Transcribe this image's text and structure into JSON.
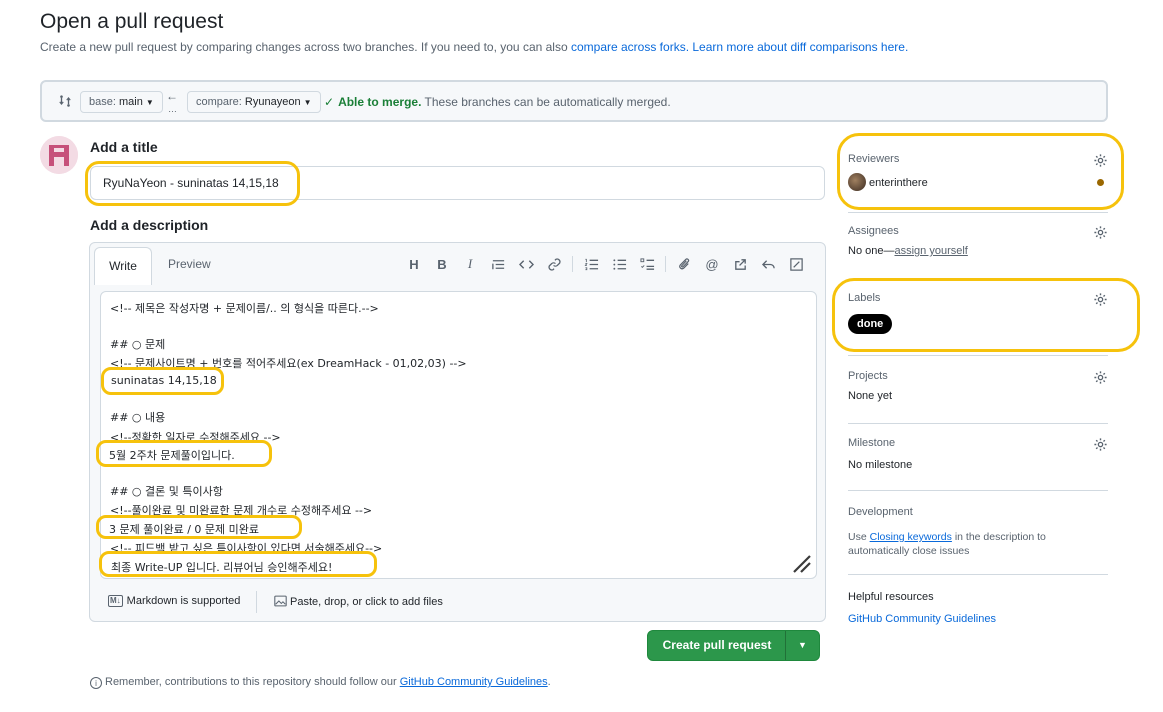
{
  "header": {
    "title": "Open a pull request",
    "subtitle_text": "Create a new pull request by comparing changes across two branches. If you need to, you can also",
    "compare_forks_link": "compare across forks.",
    "learn_more_link": "Learn more about diff comparisons here."
  },
  "branches": {
    "base_prefix": "base:",
    "base_value": "main",
    "compare_prefix": "compare:",
    "compare_value": "Ryunayeon",
    "merge_status_bold": "Able to merge.",
    "merge_status_text": "These branches can be automatically merged."
  },
  "form": {
    "title_label": "Add a title",
    "title_value": "RyuNaYeon - suninatas 14,15,18",
    "description_label": "Add a description",
    "tab_write": "Write",
    "tab_preview": "Preview",
    "description_lines": [
      "<!-- 제목은 작성자명 + 문제이름/.. 의 형식을 따른다.-->",
      "",
      "## ○ 문제",
      "<!-- 문제사이트명 + 번호를 적어주세요(ex DreamHack - 01,02,03) -->",
      "suninatas 14,15,18",
      "",
      "## ○ 내용",
      "<!--정확한 일자로 수정해주세요 -->",
      "5월 2주차 문제풀이입니다.",
      "",
      "## ○ 결론 및 특이사항",
      "<!--풀이완료 및 미완료한 문제 개수로 수정해주세요 -->",
      "3 문제 풀이완료 / 0 문제 미완료",
      "<!-- 피드백 받고 싶은 특이사항이 있다면 서술해주세요-->",
      "최종 Write-UP 입니다.  리뷰어님 승인해주세요!"
    ],
    "markdown_supported": "Markdown is supported",
    "attach_files": "Paste, drop, or click to add files",
    "create_button": "Create pull request"
  },
  "remember": {
    "text": "Remember, contributions to this repository should follow our",
    "link": "GitHub Community Guidelines",
    "end": "."
  },
  "sidebar": {
    "reviewers": {
      "title": "Reviewers",
      "user": "enterinthere",
      "status_color": "#9a6700"
    },
    "assignees": {
      "title": "Assignees",
      "none": "No one—",
      "assign_yourself": "assign yourself"
    },
    "labels": {
      "title": "Labels",
      "label": "done",
      "label_color": "#000000"
    },
    "projects": {
      "title": "Projects",
      "value": "None yet"
    },
    "milestone": {
      "title": "Milestone",
      "value": "No milestone"
    },
    "development": {
      "title": "Development",
      "prefix": "Use",
      "link": "Closing keywords",
      "suffix": "in the description to",
      "line2": "automatically close issues"
    },
    "helpful": {
      "title": "Helpful resources",
      "link": "GitHub Community Guidelines"
    }
  },
  "colors": {
    "highlight": "#f6c20c",
    "merge_ok": "#1a7f37",
    "primary_button": "#2c974b",
    "link": "#0969da"
  }
}
